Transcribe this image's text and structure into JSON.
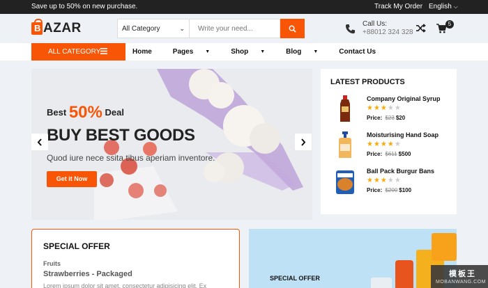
{
  "topbar": {
    "promo": "Save up to 50% on new purchase.",
    "track": "Track My Order",
    "language": "English"
  },
  "header": {
    "logo_letter": "B",
    "logo_text": "AZAR",
    "search_category": "All Category",
    "search_placeholder": "Write your need...",
    "call_label": "Call Us:",
    "call_number": "+88012 324 328",
    "cart_count": "5"
  },
  "nav": {
    "all_category": "ALL CATEGORY",
    "links": [
      "Home",
      "Pages",
      "Shop",
      "Blog",
      "Contact Us"
    ]
  },
  "hero": {
    "best": "Best",
    "percent": "50%",
    "deal": "Deal",
    "title": "BUY BEST GOODS",
    "subtitle": "Quod iure nece ssita tibus aperiam inventore.",
    "cta": "Get it Now"
  },
  "latest": {
    "title": "LATEST PRODUCTS",
    "items": [
      {
        "name": "Company Original Syrup",
        "rating": 3,
        "price_label": "Price:",
        "old_price": "$23",
        "price": "$20",
        "image_icon": "syrup-bottle-icon"
      },
      {
        "name": "Moisturising Hand Soap",
        "rating": 4,
        "price_label": "Price:",
        "old_price": "$611",
        "price": "$500",
        "image_icon": "soap-bottle-icon"
      },
      {
        "name": "Ball Pack Burgur Bans",
        "rating": 3,
        "price_label": "Price:",
        "old_price": "$200",
        "price": "$100",
        "image_icon": "bun-pack-icon"
      }
    ]
  },
  "special": {
    "title": "SPECIAL OFFER",
    "category": "Fruits",
    "product": "Strawberries - Packaged",
    "description": "Lorem ipsum dolor sit amet, consectetur adipisicing elit. Ex"
  },
  "banner2": {
    "label": "SPECIAL OFFER"
  },
  "watermark": {
    "line1": "模板王",
    "line2": "MOBANWANG.COM"
  },
  "colors": {
    "accent": "#f85606",
    "dark": "#222222",
    "star": "#fca804"
  }
}
